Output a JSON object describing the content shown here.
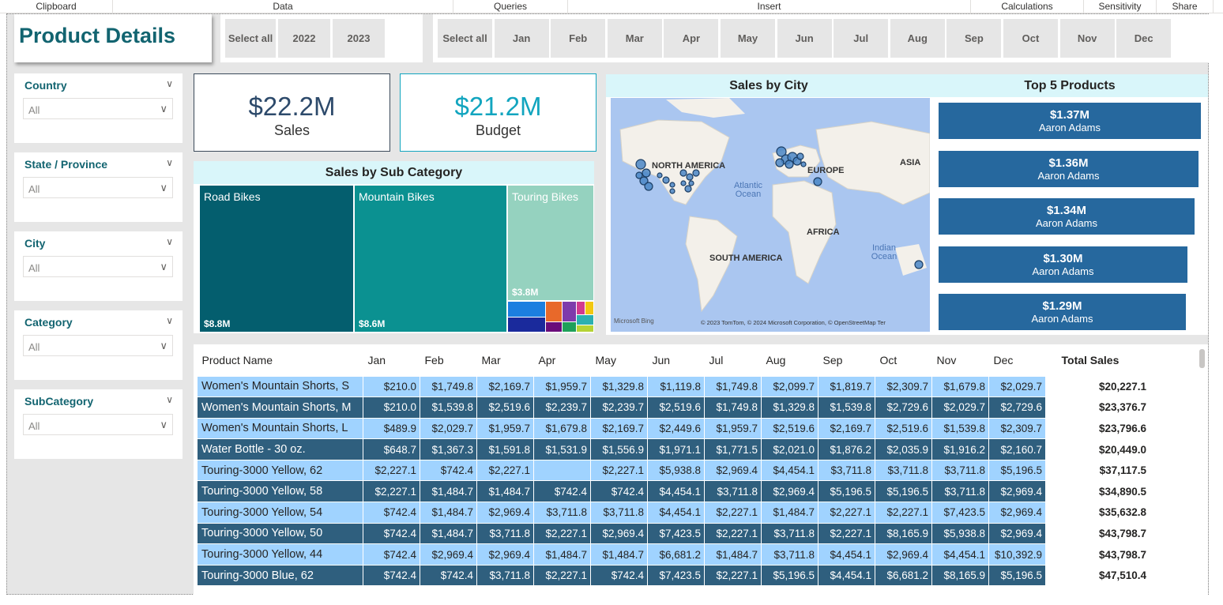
{
  "ribbon": [
    "Clipboard",
    "Data",
    "Queries",
    "Insert",
    "Calculations",
    "Sensitivity",
    "Share"
  ],
  "page_title": "Product Details",
  "year_tiles": [
    "Select all",
    "2022",
    "2023"
  ],
  "month_tiles": [
    "Select all",
    "Jan",
    "Feb",
    "Mar",
    "Apr",
    "May",
    "Jun",
    "Jul",
    "Aug",
    "Sep",
    "Oct",
    "Nov",
    "Dec"
  ],
  "slicers": [
    {
      "label": "Country",
      "value": "All"
    },
    {
      "label": "State / Province",
      "value": "All"
    },
    {
      "label": "City",
      "value": "All"
    },
    {
      "label": "Category",
      "value": "All"
    },
    {
      "label": "SubCategory",
      "value": "All"
    }
  ],
  "kpis": [
    {
      "value": "$22.2M",
      "label": "Sales",
      "color": "#2d4a6b"
    },
    {
      "value": "$21.2M",
      "label": "Budget",
      "color": "#12a5bf"
    }
  ],
  "treemap": {
    "title": "Sales by Sub Category",
    "items": [
      {
        "label": "Road Bikes",
        "value": "$8.8M",
        "color": "#045e6e"
      },
      {
        "label": "Mountain Bikes",
        "value": "$8.6M",
        "color": "#0b9191"
      },
      {
        "label": "Touring Bikes",
        "value": "$3.8M",
        "color": "#95d2bf"
      }
    ]
  },
  "map": {
    "title": "Sales by City",
    "labels": [
      "NORTH AMERICA",
      "EUROPE",
      "ASIA",
      "Atlantic Ocean",
      "AFRICA",
      "SOUTH AMERICA",
      "Indian Ocean"
    ],
    "bing": "Microsoft Bing",
    "attribution": "© 2023 TomTom, © 2024 Microsoft Corporation, © OpenStreetMap  Ter"
  },
  "top5": {
    "title": "Top 5 Products",
    "items": [
      {
        "value": "$1.37M",
        "name": "Aaron Adams"
      },
      {
        "value": "$1.36M",
        "name": "Aaron Adams"
      },
      {
        "value": "$1.34M",
        "name": "Aaron Adams"
      },
      {
        "value": "$1.30M",
        "name": "Aaron Adams"
      },
      {
        "value": "$1.29M",
        "name": "Aaron Adams"
      }
    ]
  },
  "table": {
    "headers": [
      "Product Name",
      "Jan",
      "Feb",
      "Mar",
      "Apr",
      "May",
      "Jun",
      "Jul",
      "Aug",
      "Sep",
      "Oct",
      "Nov",
      "Dec",
      "Total Sales"
    ],
    "rows": [
      [
        "Women's Mountain Shorts, S",
        "$210.0",
        "$1,749.8",
        "$2,169.7",
        "$1,959.7",
        "$1,329.8",
        "$1,119.8",
        "$1,749.8",
        "$2,099.7",
        "$1,819.7",
        "$2,309.7",
        "$1,679.8",
        "$2,029.7",
        "$20,227.1"
      ],
      [
        "Women's Mountain Shorts, M",
        "$210.0",
        "$1,539.8",
        "$2,519.6",
        "$2,239.7",
        "$2,239.7",
        "$2,519.6",
        "$1,749.8",
        "$1,329.8",
        "$1,539.8",
        "$2,729.6",
        "$2,029.7",
        "$2,729.6",
        "$23,376.7"
      ],
      [
        "Women's Mountain Shorts, L",
        "$489.9",
        "$2,029.7",
        "$1,959.7",
        "$1,679.8",
        "$2,169.7",
        "$2,449.6",
        "$1,959.7",
        "$2,519.6",
        "$2,169.7",
        "$2,519.6",
        "$1,539.8",
        "$2,309.7",
        "$23,796.6"
      ],
      [
        "Water Bottle - 30 oz.",
        "$648.7",
        "$1,367.3",
        "$1,591.8",
        "$1,531.9",
        "$1,556.9",
        "$1,971.1",
        "$1,771.5",
        "$2,021.0",
        "$1,876.2",
        "$2,035.9",
        "$1,916.2",
        "$2,160.7",
        "$20,449.0"
      ],
      [
        "Touring-3000 Yellow, 62",
        "$2,227.1",
        "$742.4",
        "$2,227.1",
        "",
        "$2,227.1",
        "$5,938.8",
        "$2,969.4",
        "$4,454.1",
        "$3,711.8",
        "$3,711.8",
        "$3,711.8",
        "$5,196.5",
        "$37,117.5"
      ],
      [
        "Touring-3000 Yellow, 58",
        "$2,227.1",
        "$1,484.7",
        "$1,484.7",
        "$742.4",
        "$742.4",
        "$4,454.1",
        "$3,711.8",
        "$2,969.4",
        "$5,196.5",
        "$5,196.5",
        "$3,711.8",
        "$2,969.4",
        "$34,890.5"
      ],
      [
        "Touring-3000 Yellow, 54",
        "$742.4",
        "$1,484.7",
        "$2,969.4",
        "$3,711.8",
        "$3,711.8",
        "$4,454.1",
        "$2,227.1",
        "$1,484.7",
        "$2,227.1",
        "$2,227.1",
        "$7,423.5",
        "$2,969.4",
        "$35,632.8"
      ],
      [
        "Touring-3000 Yellow, 50",
        "$742.4",
        "$1,484.7",
        "$3,711.8",
        "$2,227.1",
        "$2,969.4",
        "$7,423.5",
        "$2,227.1",
        "$3,711.8",
        "$2,227.1",
        "$8,165.9",
        "$5,938.8",
        "$2,969.4",
        "$43,798.7"
      ],
      [
        "Touring-3000 Yellow, 44",
        "$742.4",
        "$2,969.4",
        "$2,969.4",
        "$1,484.7",
        "$1,484.7",
        "$6,681.2",
        "$1,484.7",
        "$3,711.8",
        "$4,454.1",
        "$2,969.4",
        "$4,454.1",
        "$10,392.9",
        "$43,798.7"
      ],
      [
        "Touring-3000 Blue, 62",
        "$742.4",
        "$742.4",
        "$3,711.8",
        "$2,227.1",
        "$742.4",
        "$7,423.5",
        "$2,227.1",
        "$5,196.5",
        "$4,454.1",
        "$6,681.2",
        "$8,165.9",
        "$5,196.5",
        "$47,510.4"
      ]
    ]
  }
}
